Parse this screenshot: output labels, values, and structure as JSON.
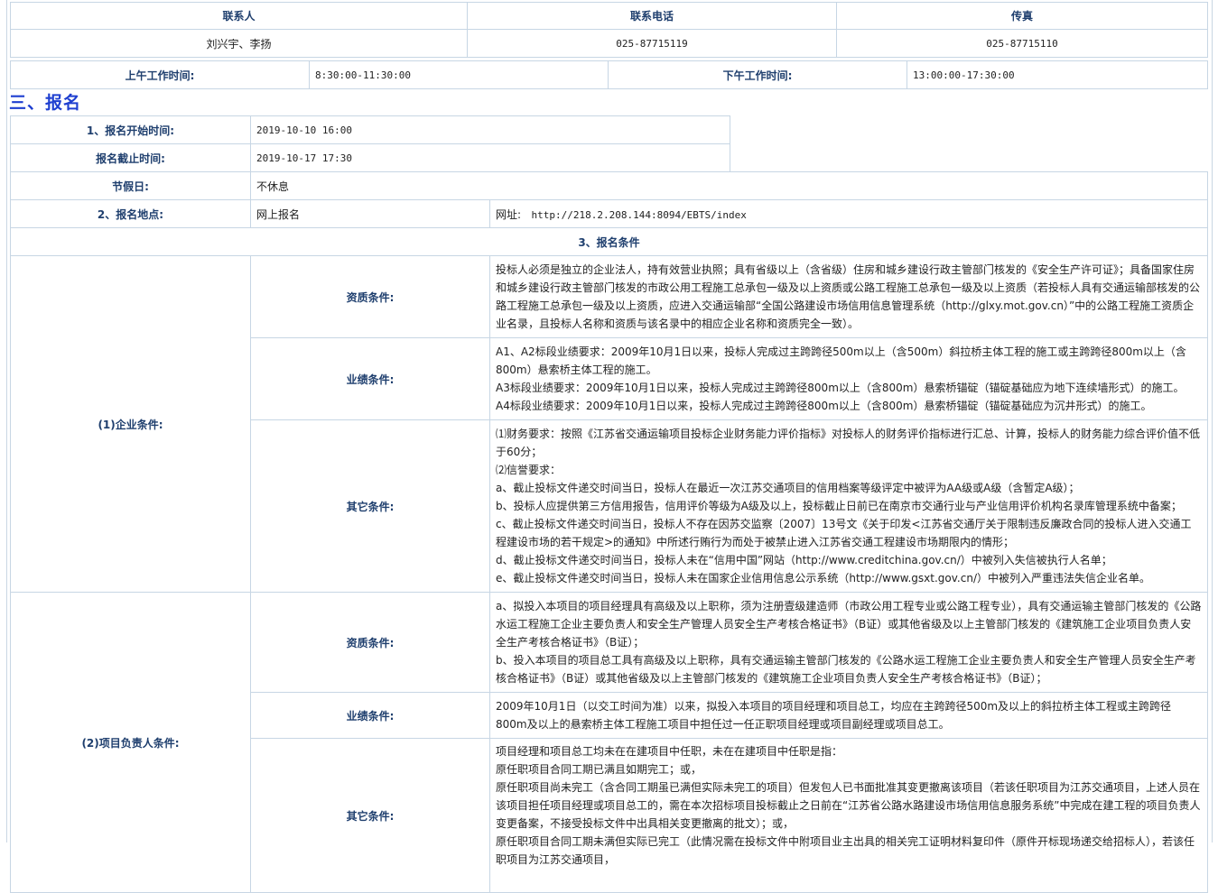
{
  "contact": {
    "headers": [
      "联系人",
      "联系电话",
      "传真"
    ],
    "values": [
      "刘兴宇、李扬",
      "025-87715119",
      "025-87715110"
    ]
  },
  "work_hours": {
    "am_label": "上午工作时间:",
    "am_value": "8:30:00-11:30:00",
    "pm_label": "下午工作时间:",
    "pm_value": "13:00:00-17:30:00"
  },
  "section_title": "三、报名",
  "registration": {
    "start_label": "1、报名开始时间:",
    "start_value": "2019-10-10 16:00",
    "end_label": "报名截止时间:",
    "end_value": "2019-10-17 17:30",
    "holiday_label": "节假日:",
    "holiday_value": "不休息",
    "place_label": "2、报名地点:",
    "place_value": "网上报名",
    "url_label": "网址:",
    "url_value": "http://218.2.208.144:8094/EBTS/index",
    "conditions_title": "3、报名条件"
  },
  "enterprise": {
    "label": "(1)企业条件:",
    "qual_label": "资质条件:",
    "qual_text": "投标人必须是独立的企业法人，持有效营业执照；具有省级以上（含省级）住房和城乡建设行政主管部门核发的《安全生产许可证》；具备国家住房和城乡建设行政主管部门核发的市政公用工程施工总承包一级及以上资质或公路工程施工总承包一级及以上资质（若投标人具有交通运输部核发的公路工程施工总承包一级及以上资质，应进入交通运输部“全国公路建设市场信用信息管理系统（http://glxy.mot.gov.cn）”中的公路工程施工资质企业名录，且投标人名称和资质与该名录中的相应企业名称和资质完全一致）。",
    "perf_label": "业绩条件:",
    "perf_lines": [
      "A1、A2标段业绩要求：2009年10月1日以来，投标人完成过主跨跨径500m以上（含500m）斜拉桥主体工程的施工或主跨跨径800m以上（含800m）悬索桥主体工程的施工。",
      "A3标段业绩要求：2009年10月1日以来，投标人完成过主跨跨径800m以上（含800m）悬索桥锚碇（锚碇基础应为地下连续墙形式）的施工。",
      "A4标段业绩要求：2009年10月1日以来，投标人完成过主跨跨径800m以上（含800m）悬索桥锚碇（锚碇基础应为沉井形式）的施工。"
    ],
    "other_label": "其它条件:",
    "other_lines": [
      "⑴财务要求：按照《江苏省交通运输项目投标企业财务能力评价指标》对投标人的财务评价指标进行汇总、计算，投标人的财务能力综合评价值不低于60分；",
      "⑵信誉要求：",
      "a、截止投标文件递交时间当日，投标人在最近一次江苏交通项目的信用档案等级评定中被评为AA级或A级（含暂定A级）；",
      "b、投标人应提供第三方信用报告，信用评价等级为A级及以上，投标截止日前已在南京市交通行业与产业信用评价机构名录库管理系统中备案；",
      "c、截止投标文件递交时间当日，投标人不存在因苏交监察〔2007〕13号文《关于印发<江苏省交通厅关于限制违反廉政合同的投标人进入交通工程建设市场的若干规定>的通知》中所述行贿行为而处于被禁止进入江苏省交通工程建设市场期限内的情形；",
      "d、截止投标文件递交时间当日，投标人未在“信用中国”网站（http://www.creditchina.gov.cn/）中被列入失信被执行人名单；",
      "e、截止投标文件递交时间当日，投标人未在国家企业信用信息公示系统（http://www.gsxt.gov.cn/）中被列入严重违法失信企业名单。"
    ]
  },
  "project_lead": {
    "label": "(2)项目负责人条件:",
    "qual_label": "资质条件:",
    "qual_lines": [
      "a、拟投入本项目的项目经理具有高级及以上职称，须为注册壹级建造师（市政公用工程专业或公路工程专业），具有交通运输主管部门核发的《公路水运工程施工企业主要负责人和安全生产管理人员安全生产考核合格证书》（B证）或其他省级及以上主管部门核发的《建筑施工企业项目负责人安全生产考核合格证书》（B证）；",
      "b、投入本项目的项目总工具有高级及以上职称，具有交通运输主管部门核发的《公路水运工程施工企业主要负责人和安全生产管理人员安全生产考核合格证书》（B证）或其他省级及以上主管部门核发的《建筑施工企业项目负责人安全生产考核合格证书》（B证）；"
    ],
    "perf_label": "业绩条件:",
    "perf_text": "2009年10月1日（以交工时间为准）以来，拟投入本项目的项目经理和项目总工，均应在主跨跨径500m及以上的斜拉桥主体工程或主跨跨径800m及以上的悬索桥主体工程施工项目中担任过一任正职项目经理或项目副经理或项目总工。",
    "other_label": "其它条件:",
    "other_lines": [
      "项目经理和项目总工均未在在建项目中任职，未在在建项目中任职是指：",
      "原任职项目合同工期已满且如期完工；或，",
      "原任职项目尚未完工（含合同工期虽已满但实际未完工的项目）但发包人已书面批准其变更撤离该项目（若该任职项目为江苏交通项目，上述人员在该项目担任项目经理或项目总工的，需在本次招标项目投标截止之日前在“江苏省公路水路建设市场信用信息服务系统”中完成在建工程的项目负责人变更备案，不接受投标文件中出具相关变更撤离的批文）；或，",
      "原任职项目合同工期未满但实际已完工（此情况需在投标文件中附项目业主出具的相关完工证明材料复印件（原件开标现场递交给招标人），若该任职项目为江苏交通项目，"
    ]
  }
}
